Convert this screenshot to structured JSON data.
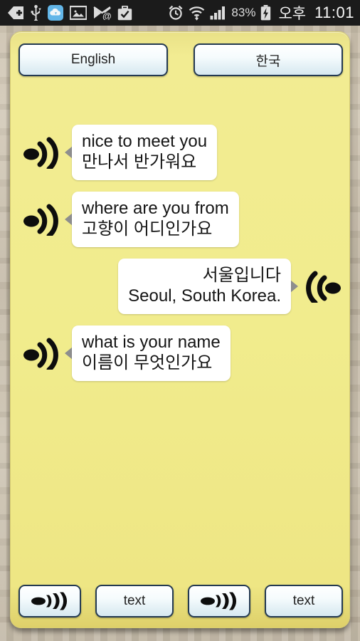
{
  "status_bar": {
    "icons": [
      {
        "name": "back-arrow-plus-icon",
        "glyph": "back-plus"
      },
      {
        "name": "usb-icon",
        "glyph": "usb"
      },
      {
        "name": "cloud-sync-icon",
        "glyph": "cloud"
      },
      {
        "name": "gallery-image-icon",
        "glyph": "image"
      },
      {
        "name": "email-icon",
        "glyph": "mail-at"
      },
      {
        "name": "briefcase-check-icon",
        "glyph": "briefcase"
      }
    ],
    "right_icons": [
      {
        "name": "alarm-clock-icon",
        "glyph": "alarm"
      },
      {
        "name": "wifi-icon",
        "glyph": "wifi"
      },
      {
        "name": "cellular-signal-icon",
        "glyph": "signal"
      }
    ],
    "battery_percent": "83%",
    "battery_icon": "battery-charging-icon",
    "ampm": "오후",
    "clock": "11:01"
  },
  "language_bar": {
    "left_label": "English",
    "right_label": "한국"
  },
  "messages": [
    {
      "side": "left",
      "icon": "speaker-wave-icon",
      "line1": "nice to meet you",
      "line2": "만나서 반가워요"
    },
    {
      "side": "left",
      "icon": "speaker-wave-icon",
      "line1": "where are you from",
      "line2": "고향이 어디인가요"
    },
    {
      "side": "right",
      "icon": "speaker-wave-icon-mirrored",
      "line1": "서울입니다",
      "line2": "Seoul, South Korea."
    },
    {
      "side": "left",
      "icon": "speaker-wave-icon",
      "line1": "what is your name",
      "line2": "이름이 무엇인가요"
    }
  ],
  "toolbar": {
    "mic_left_icon": "mic-speak-icon",
    "text_left_label": "text",
    "mic_right_icon": "mic-speak-icon",
    "text_right_label": "text"
  },
  "colors": {
    "panel_yellow": "#F1EC8D",
    "button_border": "#243A52",
    "bubble_white": "#FFFFFF",
    "status_bar_bg": "#1B1B1B",
    "tail_gray": "#8E8E8E"
  }
}
